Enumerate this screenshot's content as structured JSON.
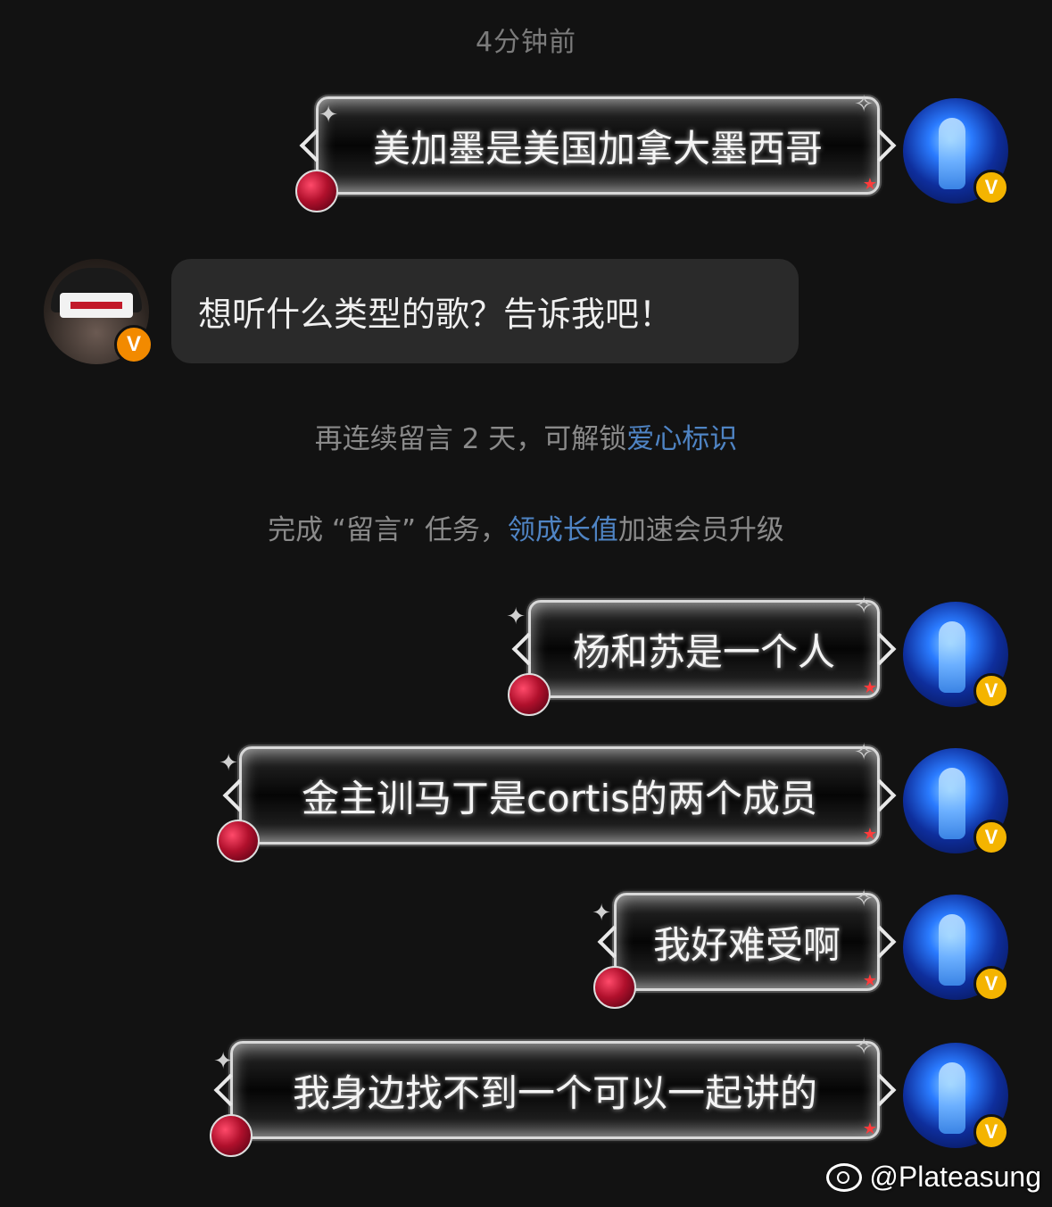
{
  "timestamp": "4分钟前",
  "messages_out": [
    {
      "text": "美加墨是美国加拿大墨西哥"
    },
    {
      "text": "杨和苏是一个人"
    },
    {
      "text": "金主训马丁是cortis的两个成员"
    },
    {
      "text": "我好难受啊"
    },
    {
      "text": "我身边找不到一个可以一起讲的"
    }
  ],
  "message_in": {
    "text": "想听什么类型的歌？告诉我吧！"
  },
  "notice_1": {
    "prefix": "再连续留言 2 天，可解锁",
    "link": "爱心标识"
  },
  "notice_2": {
    "prefix": "完成 “留言” 任务，",
    "link": "领成长值",
    "suffix": "加速会员升级"
  },
  "badge": {
    "label": "V"
  },
  "watermark": {
    "handle": "@Plateasung"
  },
  "colors": {
    "background": "#121212",
    "link": "#4f84c4",
    "badge_gold": "#f4b400",
    "badge_orange": "#f28a00"
  }
}
